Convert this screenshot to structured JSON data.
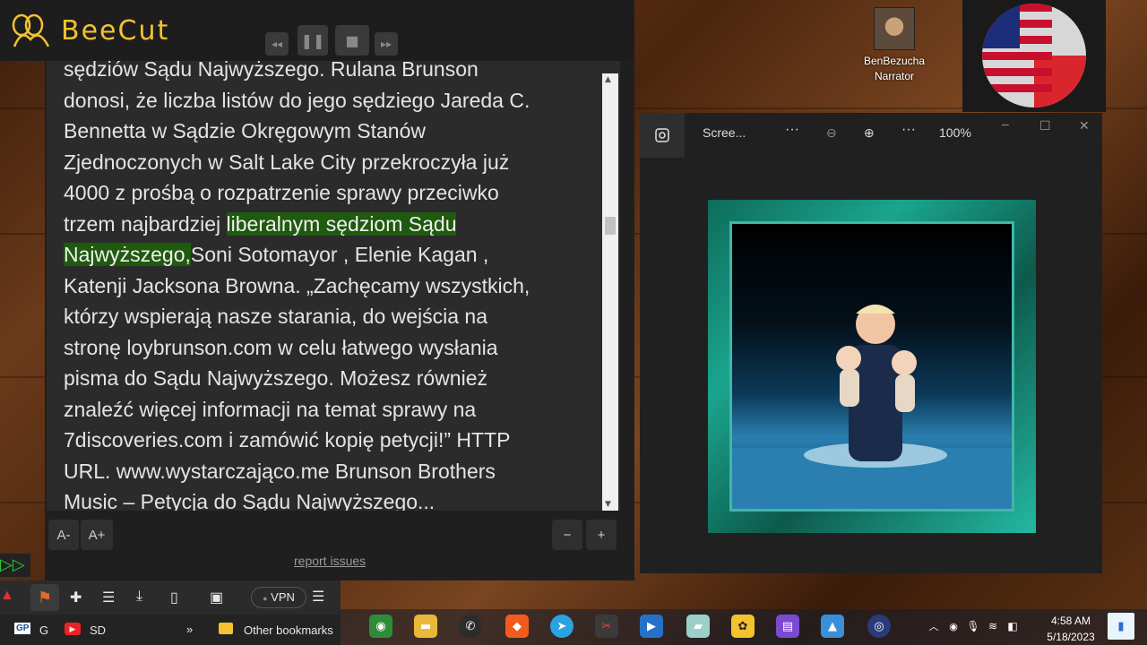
{
  "app": {
    "name": "BeeCut"
  },
  "reader": {
    "lines": [
      {
        "text": "sędziów Sądu Najwyższego. Rulana Brunson"
      },
      {
        "text": "donosi, że liczba listów do jego sędziego Jareda C."
      },
      {
        "text": "Bennetta w Sądzie Okręgowym Stanów"
      },
      {
        "text": "Zjednoczonych w Salt Lake City przekroczyła już"
      },
      {
        "text": "4000 z prośbą o rozpatrzenie sprawy przeciwko"
      },
      {
        "pre": "trzem najbardziej ",
        "hl": "liberalnym sędziom Sądu",
        "post": ""
      },
      {
        "pre": "",
        "hl": "Najwyższego,",
        "post": "Soni Sotomayor , Elenie Kagan ,"
      },
      {
        "text": "Katenji Jacksona Browna. „Zachęcamy wszystkich,"
      },
      {
        "text": "którzy wspierają nasze starania, do wejścia na"
      },
      {
        "text": "stronę loybrunson.com w celu łatwego wysłania"
      },
      {
        "text": "pisma do Sądu Najwyższego. Możesz również"
      },
      {
        "text": "znaleźć więcej informacji na temat sprawy na"
      },
      {
        "text": "7discoveries.com i zamówić kopię petycji!” HTTP"
      },
      {
        "text": "URL. www.wystarczająco.me Brunson Brothers"
      },
      {
        "text": "Music – Petycja do Sądu Najwyższego..."
      }
    ],
    "font_decrease": "A-",
    "font_increase": "A+",
    "minus": "−",
    "plus": "+",
    "report": "report issues"
  },
  "narrator": {
    "name": "BenBezucha",
    "role": "Narrator"
  },
  "viewer": {
    "title": "Scree...",
    "more": "···",
    "zoom": "100%"
  },
  "browser": {
    "vpn": "VPN",
    "bookmarks": [
      {
        "label": "G"
      },
      {
        "label": "SD"
      }
    ],
    "overflow": "»",
    "other_bookmarks": "Other bookmarks"
  },
  "clock": {
    "time": "4:58 AM",
    "date": "5/18/2023"
  },
  "colors": {
    "highlight": "#1f5a0e",
    "logo": "#f2c230"
  }
}
